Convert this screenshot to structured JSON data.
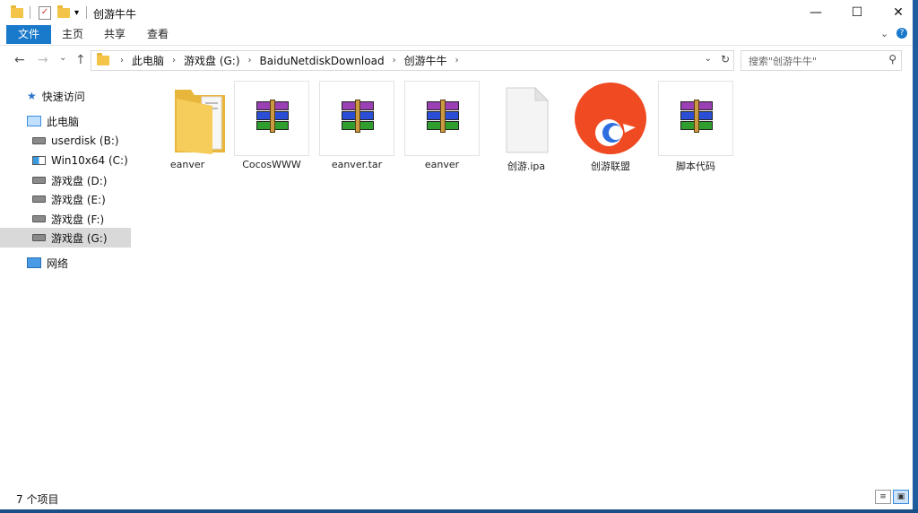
{
  "window": {
    "title": "创游牛牛"
  },
  "titlebar": {
    "minimize": "—",
    "maximize": "☐",
    "close": "✕",
    "qa_more": "▾"
  },
  "ribbon": {
    "tabs": [
      "文件",
      "主页",
      "共享",
      "查看"
    ],
    "collapse": "⌄",
    "help": "?"
  },
  "nav": {
    "back": "←",
    "forward": "→",
    "recent": "⌄",
    "up": "↑"
  },
  "address": {
    "crumbs": [
      "此电脑",
      "游戏盘 (G:)",
      "BaiduNetdiskDownload",
      "创游牛牛"
    ],
    "sep": "›",
    "dropdown": "⌄",
    "refresh": "↻"
  },
  "search": {
    "placeholder": "搜索\"创游牛牛\"",
    "icon": "⚲"
  },
  "sidebar": {
    "quick_access": "快速访问",
    "this_pc": "此电脑",
    "drives": [
      "userdisk (B:)",
      "Win10x64 (C:)",
      "游戏盘 (D:)",
      "游戏盘 (E:)",
      "游戏盘 (F:)",
      "游戏盘 (G:)"
    ],
    "network": "网络"
  },
  "files": [
    {
      "name": "eanver",
      "kind": "folder"
    },
    {
      "name": "CocosWWW",
      "kind": "archive"
    },
    {
      "name": "eanver.tar",
      "kind": "archive"
    },
    {
      "name": "eanver",
      "kind": "archive"
    },
    {
      "name": "创游.ipa",
      "kind": "blank"
    },
    {
      "name": "创游联盟",
      "kind": "app"
    },
    {
      "name": "脚本代码",
      "kind": "archive"
    }
  ],
  "status": {
    "count": "7 个项目"
  },
  "colors": {
    "accent": "#1979ca",
    "selected": "#d9d9d9",
    "folder": "#f3c448",
    "app": "#f04a23"
  }
}
